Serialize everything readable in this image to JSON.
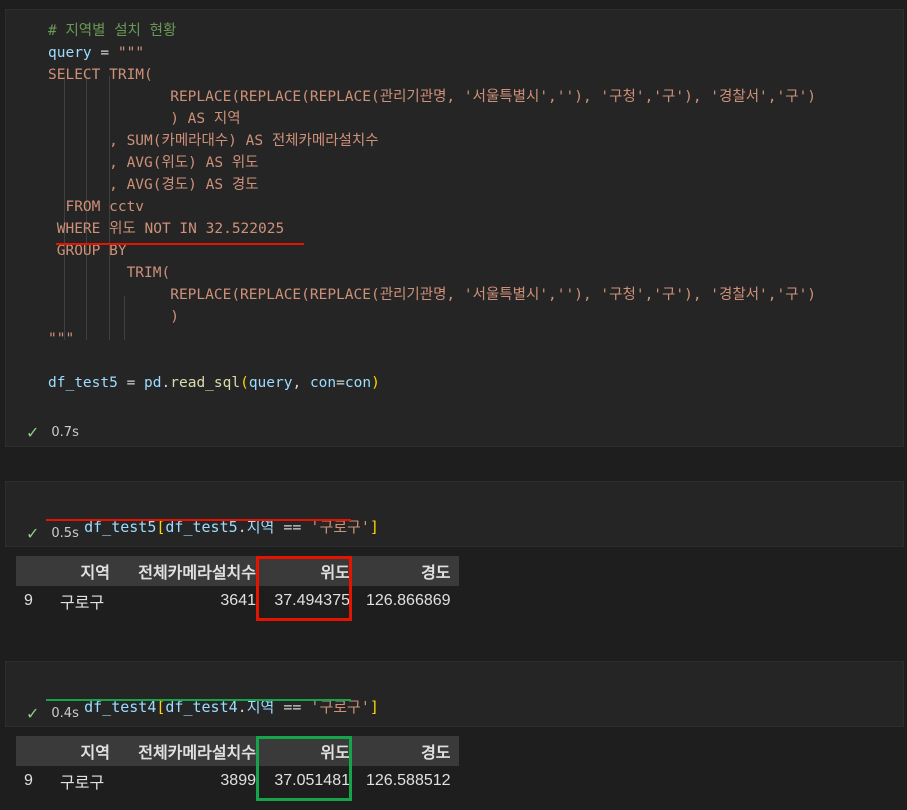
{
  "cell1": {
    "lines": [
      {
        "parts": [
          {
            "c": "cmt",
            "t": "# 지역별 설치 현황"
          }
        ]
      },
      {
        "parts": [
          {
            "c": "var",
            "t": "query"
          },
          {
            "c": "op",
            "t": " = "
          },
          {
            "c": "str",
            "t": "\"\"\""
          }
        ]
      },
      {
        "parts": [
          {
            "c": "str",
            "t": "SELECT TRIM("
          }
        ]
      },
      {
        "parts": [
          {
            "c": "str",
            "t": "              REPLACE(REPLACE(REPLACE(관리기관명, '서울특별시',''), '구청','구'), '경찰서','구')"
          }
        ]
      },
      {
        "parts": [
          {
            "c": "str",
            "t": "              ) AS 지역"
          }
        ]
      },
      {
        "parts": [
          {
            "c": "str",
            "t": "       , SUM(카메라대수) AS 전체카메라설치수"
          }
        ]
      },
      {
        "parts": [
          {
            "c": "str",
            "t": "       , AVG(위도) AS 위도"
          }
        ]
      },
      {
        "parts": [
          {
            "c": "str",
            "t": "       , AVG(경도) AS 경도"
          }
        ]
      },
      {
        "parts": [
          {
            "c": "str",
            "t": "  FROM cctv"
          }
        ]
      },
      {
        "parts": [
          {
            "c": "str",
            "t": " WHERE 위도 NOT IN 32.522025"
          }
        ]
      },
      {
        "parts": [
          {
            "c": "str",
            "t": " GROUP BY"
          }
        ]
      },
      {
        "parts": [
          {
            "c": "str",
            "t": "         TRIM("
          }
        ]
      },
      {
        "parts": [
          {
            "c": "str",
            "t": "              REPLACE(REPLACE(REPLACE(관리기관명, '서울특별시',''), '구청','구'), '경찰서','구')"
          }
        ]
      },
      {
        "parts": [
          {
            "c": "str",
            "t": "              )"
          }
        ]
      },
      {
        "parts": [
          {
            "c": "str",
            "t": "\"\"\""
          }
        ]
      },
      {
        "parts": [
          {
            "c": "op",
            "t": ""
          }
        ]
      },
      {
        "parts": [
          {
            "c": "var",
            "t": "df_test5"
          },
          {
            "c": "op",
            "t": " = "
          },
          {
            "c": "var",
            "t": "pd"
          },
          {
            "c": "op",
            "t": "."
          },
          {
            "c": "fn",
            "t": "read_sql"
          },
          {
            "c": "br1",
            "t": "("
          },
          {
            "c": "var",
            "t": "query"
          },
          {
            "c": "op",
            "t": ", "
          },
          {
            "c": "var",
            "t": "con"
          },
          {
            "c": "op",
            "t": "="
          },
          {
            "c": "var",
            "t": "con"
          },
          {
            "c": "br1",
            "t": ")"
          }
        ]
      }
    ],
    "status_time": "0.7s"
  },
  "cell2": {
    "code": {
      "var1": "df_test5",
      "br_open": "[",
      "var2": "df_test5",
      "dot": ".",
      "attr": "지역",
      "op": " == ",
      "str": "'구로구'",
      "br_close": "]"
    },
    "status_time": "0.5s",
    "table": {
      "headers": [
        "",
        "지역",
        "전체카메라설치수",
        "위도",
        "경도"
      ],
      "row": {
        "index": "9",
        "region": "구로구",
        "count": "3641",
        "lat": "37.494375",
        "lng": "126.866869"
      }
    }
  },
  "cell3": {
    "code": {
      "var1": "df_test4",
      "br_open": "[",
      "var2": "df_test4",
      "dot": ".",
      "attr": "지역",
      "op": " == ",
      "str": "'구로구'",
      "br_close": "]"
    },
    "status_time": "0.4s",
    "table": {
      "headers": [
        "",
        "지역",
        "전체카메라설치수",
        "위도",
        "경도"
      ],
      "row": {
        "index": "9",
        "region": "구로구",
        "count": "3899",
        "lat": "37.051481",
        "lng": "126.588512"
      }
    }
  },
  "colors": {
    "highlight_red": "#e51400",
    "highlight_green": "#16a34a",
    "check": "#89d185"
  },
  "icons": {
    "success": "check-icon"
  }
}
